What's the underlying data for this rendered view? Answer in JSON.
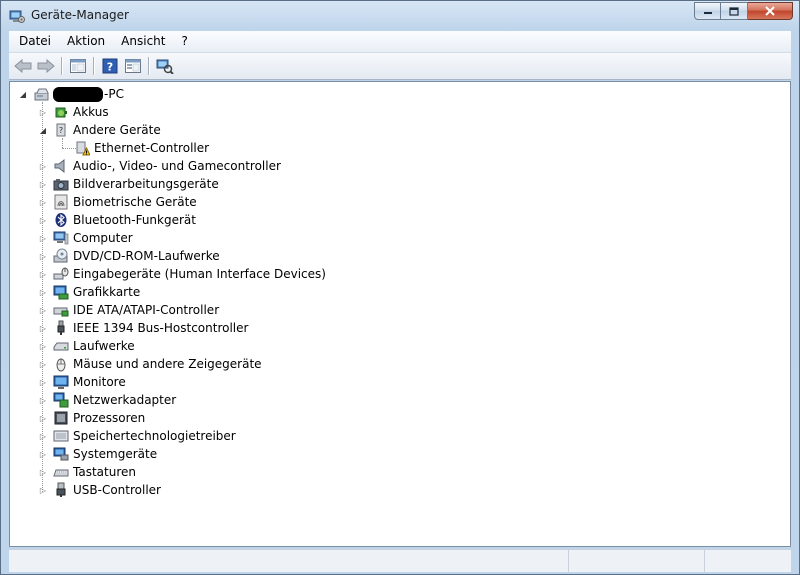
{
  "window": {
    "title": "Geräte-Manager"
  },
  "menu": [
    "Datei",
    "Aktion",
    "Ansicht",
    "?"
  ],
  "toolbar": {
    "buttons": [
      "back-icon",
      "forward-icon",
      "console-tree-icon",
      "help-icon",
      "properties-icon",
      "scan-hardware-icon"
    ]
  },
  "tree": {
    "root_label_suffix": "-PC",
    "items": [
      {
        "label": "Akkus",
        "icon": "battery-icon",
        "expanded": false
      },
      {
        "label": "Andere Geräte",
        "icon": "unknown-device-icon",
        "expanded": true
      },
      {
        "label": "Ethernet-Controller",
        "icon": "warning-device-icon",
        "child": true
      },
      {
        "label": "Audio-, Video- und Gamecontroller",
        "icon": "speaker-icon",
        "expanded": false
      },
      {
        "label": "Bildverarbeitungsgeräte",
        "icon": "camera-icon",
        "expanded": false
      },
      {
        "label": "Biometrische Geräte",
        "icon": "fingerprint-icon",
        "expanded": false
      },
      {
        "label": "Bluetooth-Funkgerät",
        "icon": "bluetooth-icon",
        "expanded": false
      },
      {
        "label": "Computer",
        "icon": "computer-icon",
        "expanded": false
      },
      {
        "label": "DVD/CD-ROM-Laufwerke",
        "icon": "disc-drive-icon",
        "expanded": false
      },
      {
        "label": "Eingabegeräte (Human Interface Devices)",
        "icon": "hid-icon",
        "expanded": false
      },
      {
        "label": "Grafikkarte",
        "icon": "display-adapter-icon",
        "expanded": false
      },
      {
        "label": "IDE ATA/ATAPI-Controller",
        "icon": "ide-controller-icon",
        "expanded": false
      },
      {
        "label": "IEEE 1394 Bus-Hostcontroller",
        "icon": "firewire-icon",
        "expanded": false
      },
      {
        "label": "Laufwerke",
        "icon": "hard-drive-icon",
        "expanded": false
      },
      {
        "label": "Mäuse und andere Zeigegeräte",
        "icon": "mouse-icon",
        "expanded": false
      },
      {
        "label": "Monitore",
        "icon": "monitor-icon",
        "expanded": false
      },
      {
        "label": "Netzwerkadapter",
        "icon": "network-adapter-icon",
        "expanded": false
      },
      {
        "label": "Prozessoren",
        "icon": "processor-icon",
        "expanded": false
      },
      {
        "label": "Speichertechnologietreiber",
        "icon": "storage-driver-icon",
        "expanded": false
      },
      {
        "label": "Systemgeräte",
        "icon": "system-devices-icon",
        "expanded": false
      },
      {
        "label": "Tastaturen",
        "icon": "keyboard-icon",
        "expanded": false
      },
      {
        "label": "USB-Controller",
        "icon": "usb-icon",
        "expanded": false
      }
    ]
  },
  "colors": {
    "frame": "#bfd5eb",
    "tree_background": "#ffffff",
    "close_button": "#c0452a"
  }
}
